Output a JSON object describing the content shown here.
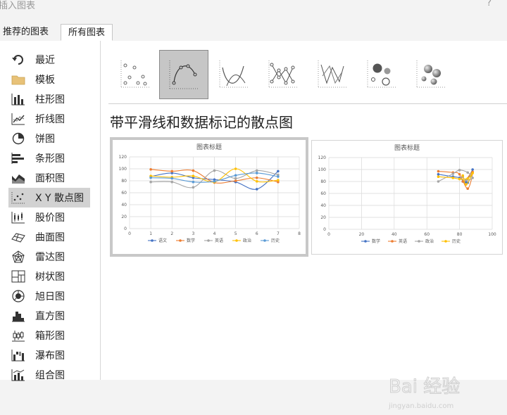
{
  "window": {
    "title": "插入图表",
    "help": "?"
  },
  "tabs": [
    {
      "label": "推荐的图表"
    },
    {
      "label": "所有图表"
    }
  ],
  "sidebar": {
    "items": [
      {
        "label": "最近",
        "icon": "undo-arrow-icon"
      },
      {
        "label": "模板",
        "icon": "folder-icon"
      },
      {
        "label": "柱形图",
        "icon": "column-chart-icon"
      },
      {
        "label": "折线图",
        "icon": "line-chart-icon"
      },
      {
        "label": "饼图",
        "icon": "pie-chart-icon"
      },
      {
        "label": "条形图",
        "icon": "bar-chart-icon"
      },
      {
        "label": "面积图",
        "icon": "area-chart-icon"
      },
      {
        "label": "X Y 散点图",
        "icon": "scatter-chart-icon"
      },
      {
        "label": "股价图",
        "icon": "stock-chart-icon"
      },
      {
        "label": "曲面图",
        "icon": "surface-chart-icon"
      },
      {
        "label": "雷达图",
        "icon": "radar-chart-icon"
      },
      {
        "label": "树状图",
        "icon": "treemap-chart-icon"
      },
      {
        "label": "旭日图",
        "icon": "sunburst-chart-icon"
      },
      {
        "label": "直方图",
        "icon": "histogram-chart-icon"
      },
      {
        "label": "箱形图",
        "icon": "box-whisker-chart-icon"
      },
      {
        "label": "瀑布图",
        "icon": "waterfall-chart-icon"
      },
      {
        "label": "组合图",
        "icon": "combo-chart-icon"
      }
    ],
    "active_index": 7
  },
  "subtypes": [
    {
      "icon": "scatter-only-icon"
    },
    {
      "icon": "scatter-smooth-markers-icon"
    },
    {
      "icon": "scatter-smooth-lines-icon"
    },
    {
      "icon": "scatter-straight-markers-icon"
    },
    {
      "icon": "scatter-straight-lines-icon"
    },
    {
      "icon": "bubble-icon"
    },
    {
      "icon": "bubble-3d-icon"
    }
  ],
  "selected_subtype_index": 1,
  "heading": "带平滑线和数据标记的散点图",
  "watermark": {
    "brand": "Bai 经验",
    "url": "jingyan.baidu.com"
  },
  "chart_data": [
    {
      "type": "scatter",
      "title": "图表标题",
      "xlim": [
        0,
        8
      ],
      "ylim": [
        0,
        120
      ],
      "xticks": [
        0,
        1,
        2,
        3,
        4,
        5,
        6,
        7,
        8
      ],
      "yticks": [
        0,
        20,
        40,
        60,
        80,
        100,
        120
      ],
      "x": [
        1,
        2,
        3,
        4,
        5,
        6,
        7
      ],
      "series": [
        {
          "name": "语文",
          "color": "#4472c4",
          "values": [
            87,
            93,
            85,
            82,
            78,
            66,
            96
          ]
        },
        {
          "name": "数学",
          "color": "#ed7d31",
          "values": [
            99,
            96,
            97,
            77,
            80,
            85,
            78
          ]
        },
        {
          "name": "英语",
          "color": "#a5a5a5",
          "values": [
            78,
            78,
            69,
            97,
            84,
            97,
            90
          ]
        },
        {
          "name": "政治",
          "color": "#ffc000",
          "values": [
            88,
            86,
            88,
            78,
            100,
            79,
            81
          ]
        },
        {
          "name": "历史",
          "color": "#5b9bd5",
          "values": [
            85,
            84,
            78,
            79,
            89,
            93,
            87
          ]
        }
      ]
    },
    {
      "type": "scatter",
      "title": "图表标题",
      "xlim": [
        0,
        100
      ],
      "ylim": [
        0,
        120
      ],
      "xticks": [
        0,
        20,
        40,
        60,
        80,
        100
      ],
      "yticks": [
        0,
        20,
        40,
        60,
        80,
        100,
        120
      ],
      "x": [
        67,
        76,
        80,
        85,
        88,
        84,
        82
      ],
      "series": [
        {
          "name": "数学",
          "color": "#4472c4",
          "values": [
            92,
            88,
            86,
            78,
            100,
            79,
            80
          ]
        },
        {
          "name": "英语",
          "color": "#ed7d31",
          "values": [
            97,
            95,
            92,
            68,
            96,
            83,
            80
          ]
        },
        {
          "name": "政治",
          "color": "#a5a5a5",
          "values": [
            80,
            93,
            99,
            95,
            86,
            82,
            88
          ]
        },
        {
          "name": "历史",
          "color": "#ffc000",
          "values": [
            88,
            86,
            84,
            85,
            94,
            75,
            90
          ]
        }
      ]
    }
  ]
}
